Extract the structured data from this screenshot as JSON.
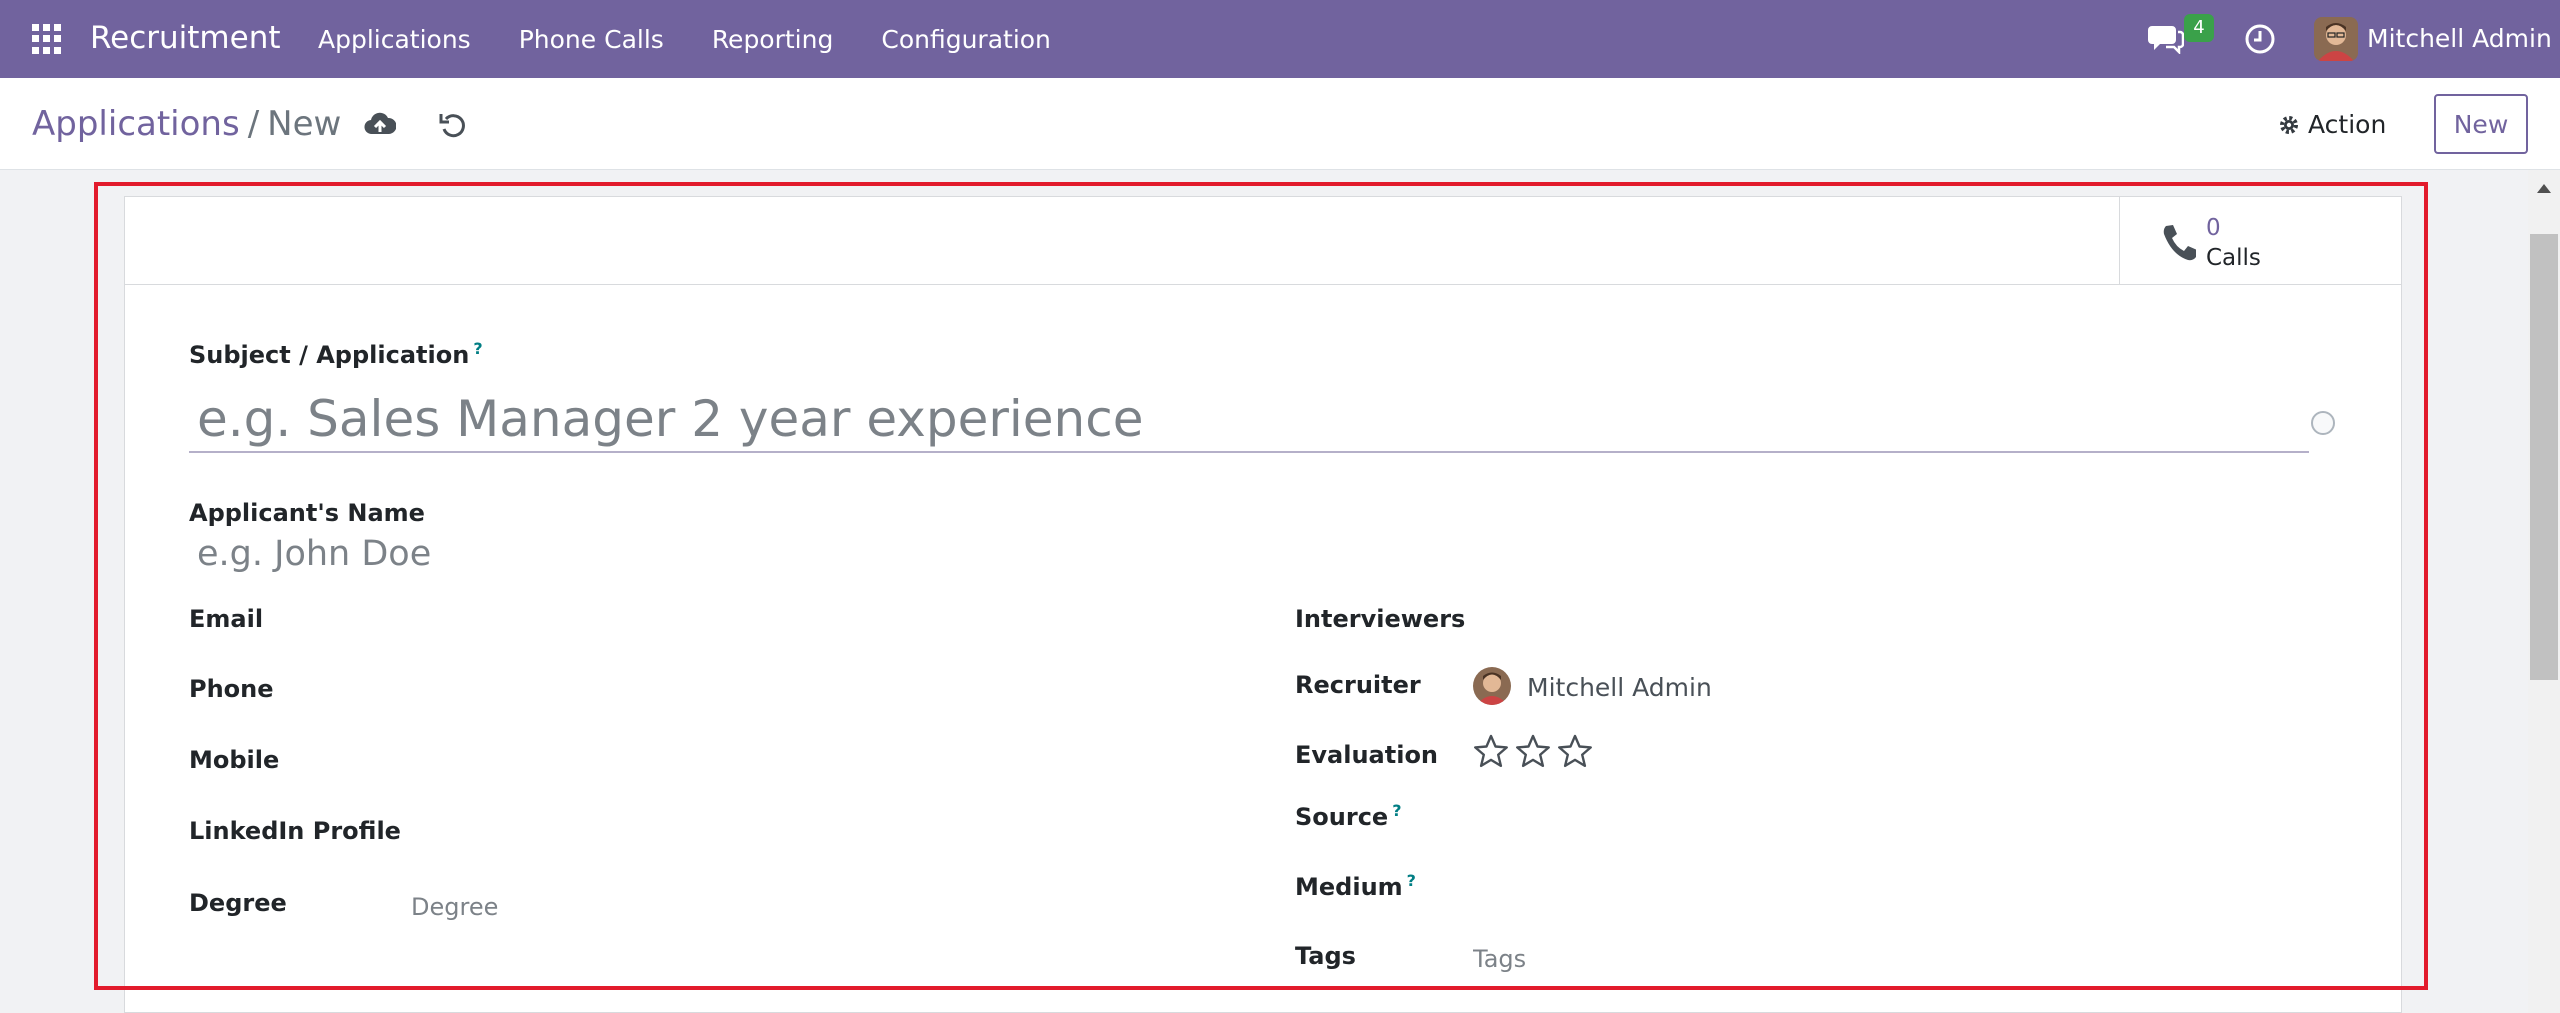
{
  "navbar": {
    "brand": "Recruitment",
    "menu": [
      "Applications",
      "Phone Calls",
      "Reporting",
      "Configuration"
    ],
    "message_count": "4",
    "user_name": "Mitchell Admin"
  },
  "control_panel": {
    "breadcrumb_parent": "Applications",
    "breadcrumb_separator": "/",
    "breadcrumb_current": "New",
    "action_label": "Action",
    "new_label": "New"
  },
  "smart_buttons": {
    "calls_count": "0",
    "calls_label": "Calls"
  },
  "form": {
    "subject_label": "Subject / Application",
    "subject_help": "?",
    "subject_placeholder": "e.g. Sales Manager 2 year experience",
    "applicant_name_label": "Applicant's Name",
    "applicant_name_placeholder": "e.g. John Doe",
    "left_fields": {
      "email": "Email",
      "phone": "Phone",
      "mobile": "Mobile",
      "linkedin": "LinkedIn Profile",
      "degree": "Degree",
      "degree_placeholder": "Degree"
    },
    "right_fields": {
      "interviewers": "Interviewers",
      "recruiter": "Recruiter",
      "recruiter_value": "Mitchell Admin",
      "evaluation": "Evaluation",
      "evaluation_stars": 0,
      "evaluation_max": 3,
      "source": "Source",
      "source_help": "?",
      "medium": "Medium",
      "medium_help": "?",
      "tags": "Tags",
      "tags_placeholder": "Tags"
    }
  },
  "colors": {
    "brand": "#71639e",
    "highlight": "#e21b2c",
    "badge": "#3aa14a"
  }
}
